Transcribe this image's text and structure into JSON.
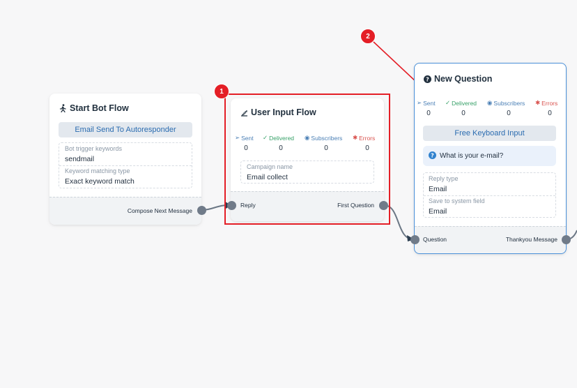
{
  "colors": {
    "accent_blue": "#4a90d9",
    "highlight_red": "#e41e26",
    "port_grey": "#707b89"
  },
  "start_node": {
    "title": "Start Bot Flow",
    "icon": "walking-person-icon",
    "action_button": "Email Send To Autoresponder",
    "fields": [
      {
        "label": "Bot trigger keywords",
        "value": "sendmail"
      },
      {
        "label": "Keyword matching type",
        "value": "Exact keyword match"
      }
    ],
    "output_port": "Compose Next Message"
  },
  "input_node": {
    "title": "User Input Flow",
    "icon": "staircase-icon",
    "stats": [
      {
        "label": "Sent",
        "value": "0"
      },
      {
        "label": "Delivered",
        "value": "0"
      },
      {
        "label": "Subscribers",
        "value": "0"
      },
      {
        "label": "Errors",
        "value": "0"
      }
    ],
    "field": {
      "label": "Campaign name",
      "value": "Email collect"
    },
    "input_port": "Reply",
    "output_port": "First Question"
  },
  "question_node": {
    "title": "New Question",
    "icon": "question-circle-icon",
    "stats": [
      {
        "label": "Sent",
        "value": "0"
      },
      {
        "label": "Delivered",
        "value": "0"
      },
      {
        "label": "Subscribers",
        "value": "0"
      },
      {
        "label": "Errors",
        "value": "0"
      }
    ],
    "action_button": "Free Keyboard Input",
    "question_text": "What is your e-mail?",
    "fields": [
      {
        "label": "Reply type",
        "value": "Email"
      },
      {
        "label": "Save to system field",
        "value": "Email"
      }
    ],
    "input_port": "Question",
    "output_port": "Thankyou Message"
  },
  "annotations": [
    {
      "number": "1"
    },
    {
      "number": "2"
    }
  ]
}
